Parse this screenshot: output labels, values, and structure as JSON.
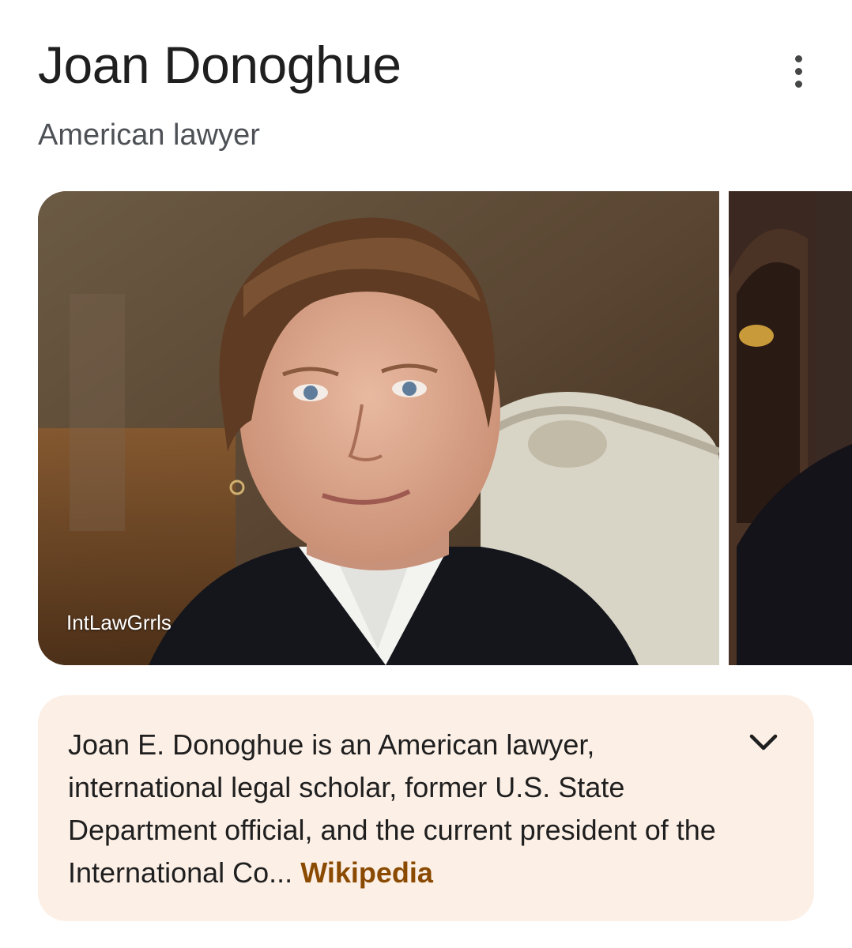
{
  "entity": {
    "title": "Joan Donoghue",
    "subtitle": "American lawyer"
  },
  "images": [
    {
      "source": "IntLawGrrls"
    }
  ],
  "description": {
    "text": "Joan E. Donoghue is an American lawyer, international legal scholar, former U.S. State Department official, and the current president of the International Co...",
    "link_label": "Wikipedia"
  },
  "icons": {
    "more": "more-vert-icon",
    "expand": "chevron-down-icon"
  },
  "colors": {
    "card_background": "#fcefe6",
    "link": "#8a4a00"
  }
}
